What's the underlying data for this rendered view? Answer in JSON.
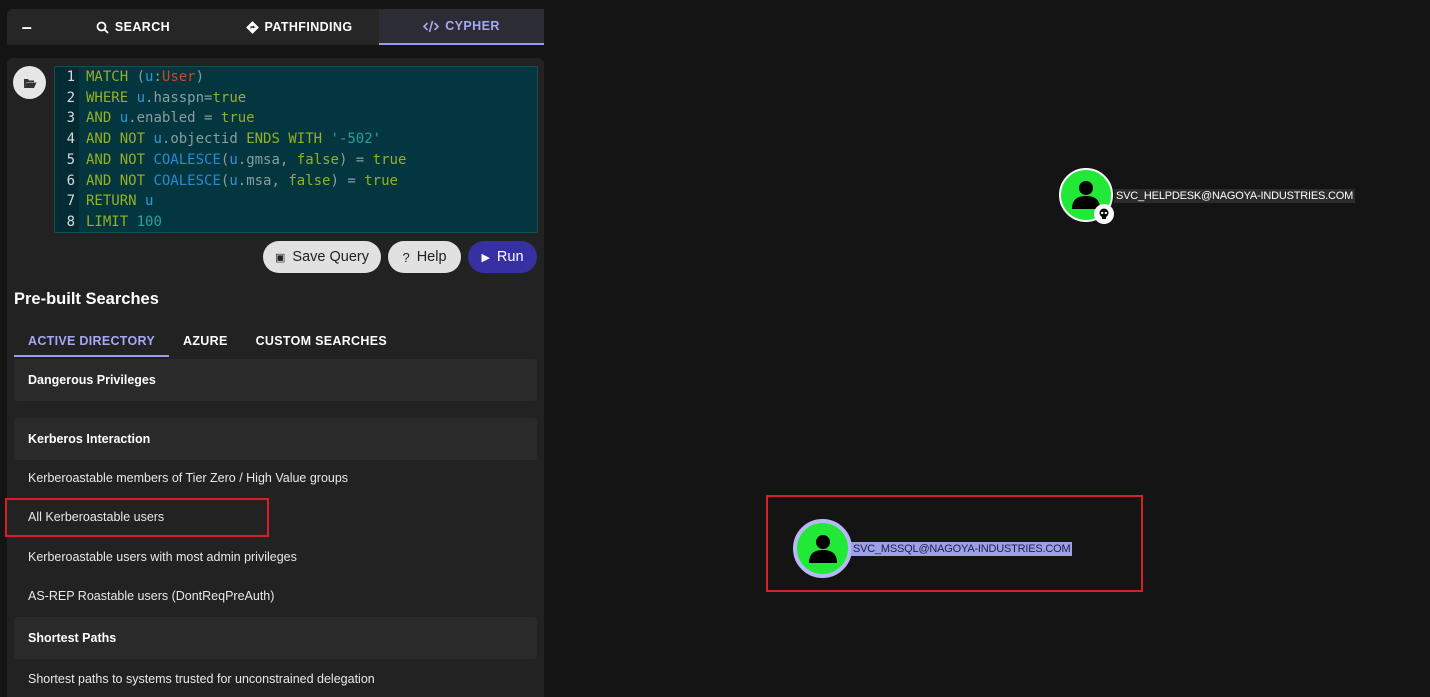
{
  "tabs": {
    "collapse": "–",
    "search": "SEARCH",
    "pathfinding": "PATHFINDING",
    "cypher": "CYPHER"
  },
  "editor": {
    "line_numbers": [
      "1",
      "2",
      "3",
      "4",
      "5",
      "6",
      "7",
      "8"
    ],
    "lines": [
      "MATCH (u:User)",
      "WHERE u.hasspn=true",
      "AND u.enabled = true",
      "AND NOT u.objectid ENDS WITH '-502'",
      "AND NOT COALESCE(u.gmsa, false) = true",
      "AND NOT COALESCE(u.msa, false) = true",
      "RETURN u",
      "LIMIT 100"
    ]
  },
  "buttons": {
    "save": "Save Query",
    "help": "Help",
    "run": "Run"
  },
  "prebuilt": {
    "title": "Pre-built Searches",
    "tabs": [
      "ACTIVE DIRECTORY",
      "AZURE",
      "CUSTOM SEARCHES"
    ],
    "items": [
      {
        "type": "header",
        "label": "Dangerous Privileges"
      },
      {
        "type": "header",
        "label": "Kerberos Interaction"
      },
      {
        "type": "query",
        "label": "Kerberoastable members of Tier Zero / High Value groups"
      },
      {
        "type": "query",
        "label": "All Kerberoastable users"
      },
      {
        "type": "query",
        "label": "Kerberoastable users with most admin privileges"
      },
      {
        "type": "query",
        "label": "AS-REP Roastable users (DontReqPreAuth)"
      },
      {
        "type": "header",
        "label": "Shortest Paths"
      },
      {
        "type": "query",
        "label": "Shortest paths to systems trusted for unconstrained delegation"
      }
    ]
  },
  "graph": {
    "nodes": [
      {
        "label": "SVC_HELPDESK@NAGOYA-INDUSTRIES.COM",
        "selected": false,
        "icon": "user-icon",
        "badge": "owned-skull-icon"
      },
      {
        "label": "SVC_MSSQL@NAGOYA-INDUSTRIES.COM",
        "selected": true,
        "icon": "user-icon"
      }
    ]
  },
  "colors": {
    "accent": "#a6a8f5",
    "run_button": "#3730a3",
    "node_fill": "#22e838",
    "highlight": "#d81f26"
  }
}
